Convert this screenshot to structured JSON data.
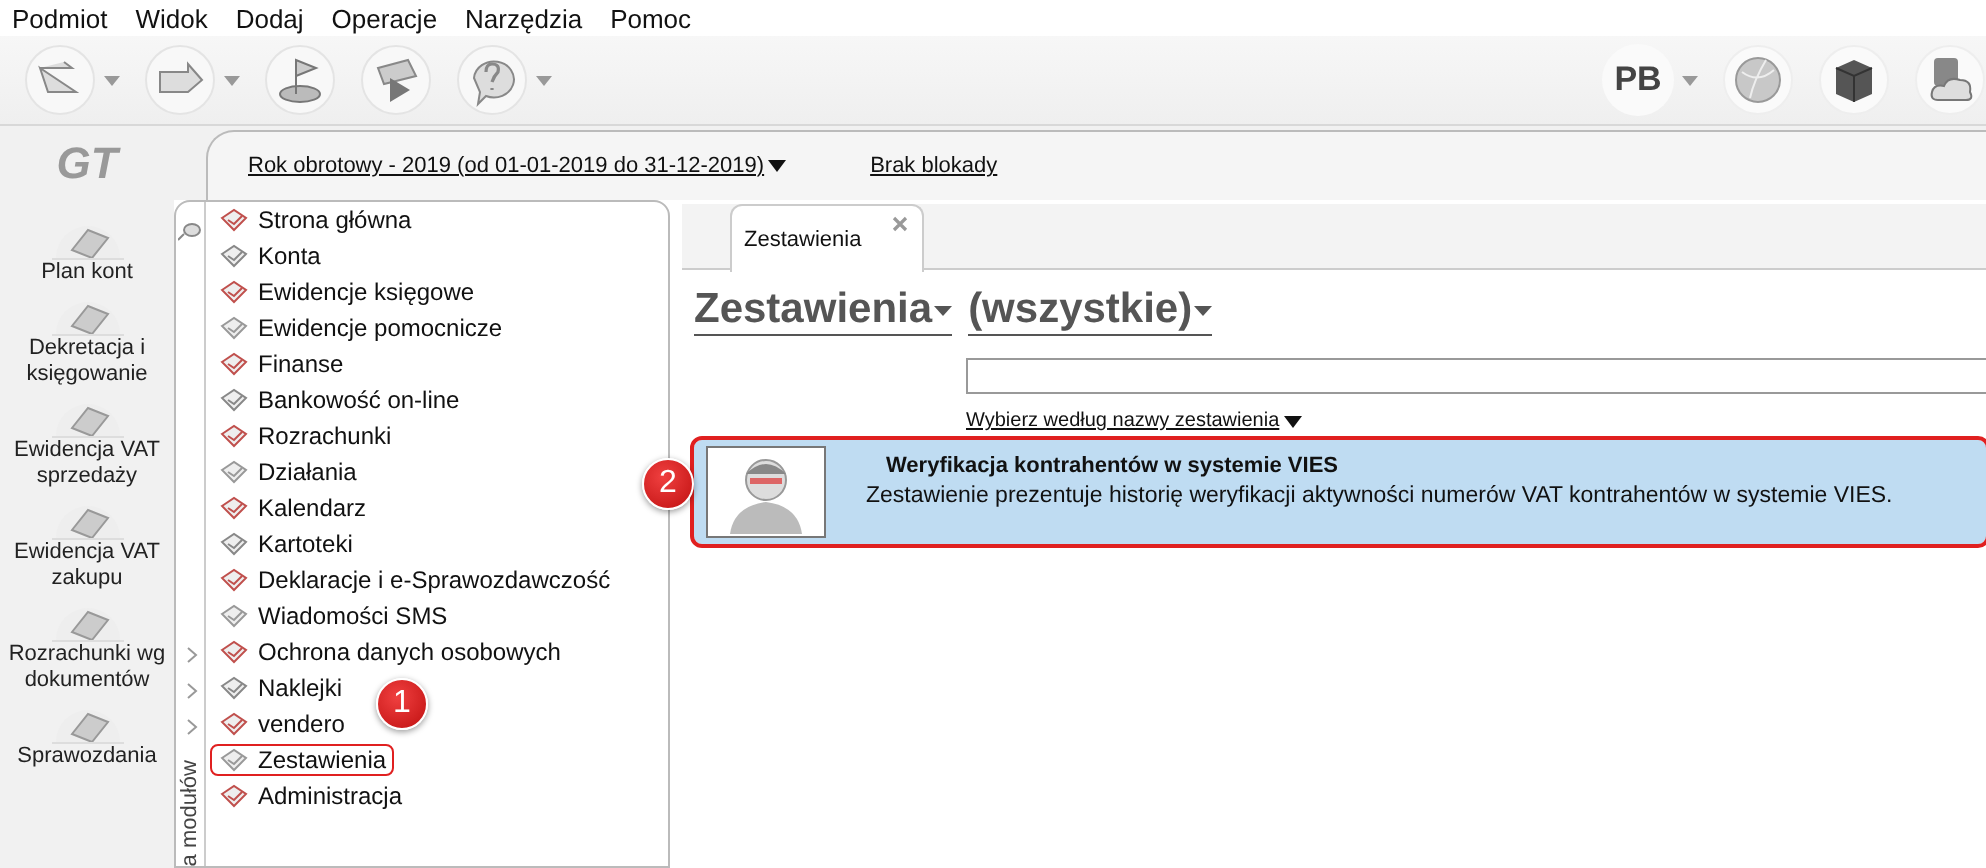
{
  "menu": [
    "Podmiot",
    "Widok",
    "Dodaj",
    "Operacje",
    "Narzędzia",
    "Pomoc"
  ],
  "toolbar": {
    "left": [
      {
        "kind": "arrow-left",
        "dropdown": true
      },
      {
        "kind": "arrow-right",
        "dropdown": true
      },
      {
        "kind": "flag",
        "dropdown": false
      },
      {
        "kind": "play",
        "dropdown": false
      },
      {
        "kind": "help",
        "dropdown": true
      }
    ],
    "user": {
      "label": "PB",
      "dropdown": true
    },
    "right": [
      {
        "kind": "globe"
      },
      {
        "kind": "cube"
      },
      {
        "kind": "cloud"
      }
    ]
  },
  "logo": "GT",
  "header": {
    "fiscal_year": "Rok obrotowy - 2019  (od 01-01-2019 do 31-12-2019)",
    "lock": "Brak blokady"
  },
  "shortcuts": [
    "Plan kont",
    "Dekretacja i księgowanie",
    "Ewidencja VAT sprzedaży",
    "Ewidencja VAT zakupu",
    "Rozrachunki wg dokumentów",
    "Sprawozdania"
  ],
  "modules_caption": "a modułów",
  "modules": [
    {
      "label": "Strona główna",
      "highlighted": false,
      "expandable": false
    },
    {
      "label": "Konta",
      "highlighted": false,
      "expandable": false
    },
    {
      "label": "Ewidencje księgowe",
      "highlighted": false,
      "expandable": false
    },
    {
      "label": "Ewidencje pomocnicze",
      "highlighted": false,
      "expandable": false
    },
    {
      "label": "Finanse",
      "highlighted": false,
      "expandable": false
    },
    {
      "label": "Bankowość on-line",
      "highlighted": false,
      "expandable": false
    },
    {
      "label": "Rozrachunki",
      "highlighted": false,
      "expandable": false
    },
    {
      "label": "Działania",
      "highlighted": false,
      "expandable": false
    },
    {
      "label": "Kalendarz",
      "highlighted": false,
      "expandable": false
    },
    {
      "label": "Kartoteki",
      "highlighted": false,
      "expandable": false
    },
    {
      "label": "Deklaracje i e-Sprawozdawczość",
      "highlighted": false,
      "expandable": false
    },
    {
      "label": "Wiadomości SMS",
      "highlighted": false,
      "expandable": false
    },
    {
      "label": "Ochrona danych osobowych",
      "highlighted": false,
      "expandable": true
    },
    {
      "label": "Naklejki",
      "highlighted": false,
      "expandable": true
    },
    {
      "label": "vendero",
      "highlighted": false,
      "expandable": true
    },
    {
      "label": "Zestawienia",
      "highlighted": true,
      "expandable": false
    },
    {
      "label": "Administracja",
      "highlighted": false,
      "expandable": false
    }
  ],
  "tabs": [
    {
      "label": "Zestawienia",
      "selected": true
    }
  ],
  "title": {
    "category": "Zestawienia",
    "filter": "(wszystkie)"
  },
  "filter_link": "Wybierz według nazwy zestawienia",
  "reports": [
    {
      "title": "Weryfikacja kontrahentów w systemie VIES",
      "description": "Zestawienie prezentuje historię weryfikacji aktywności numerów VAT kontrahentów w systemie VIES.",
      "selected": true,
      "highlighted": true
    }
  ],
  "callouts": [
    {
      "number": "1"
    },
    {
      "number": "2"
    }
  ]
}
